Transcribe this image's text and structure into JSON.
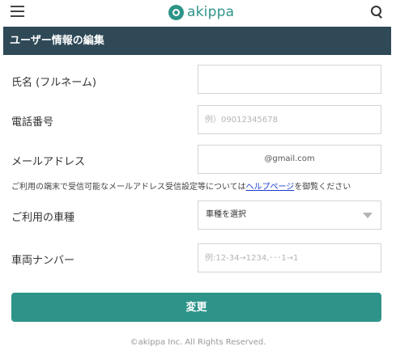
{
  "header": {
    "logo_text": "akippa",
    "menu_icon": "hamburger-menu-icon",
    "search_icon": "search-icon",
    "brand_color": "#2e9489"
  },
  "section": {
    "title": "ユーザー情報の編集",
    "bar_color": "#2f4957"
  },
  "form": {
    "name": {
      "label": "氏名 (フルネーム)",
      "value": "",
      "placeholder": ""
    },
    "phone": {
      "label": "電話番号",
      "value": "",
      "placeholder": "例）09012345678"
    },
    "email": {
      "label": "メールアドレス",
      "value": "@gmail.com"
    },
    "note": {
      "before": "ご利用の端末で受信可能なメールアドレス受信設定等については",
      "link": "ヘルプページ",
      "after": "を御覧ください"
    },
    "vehicle": {
      "label": "ご利用の車種",
      "selected": "車種を選択"
    },
    "plate": {
      "label": "車両ナンバー",
      "value": "",
      "placeholder": "例:12-34→1234,･･･1→1"
    }
  },
  "submit": {
    "label": "変更"
  },
  "footer": {
    "copyright": "©akippa Inc. All Rights Reserved."
  }
}
